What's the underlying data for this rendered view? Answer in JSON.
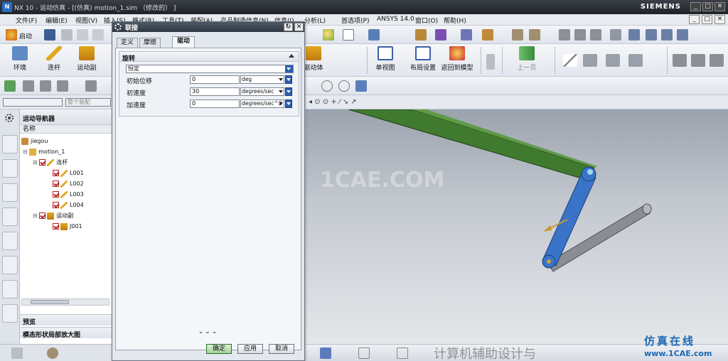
{
  "titlebar": {
    "title": "NX 10 - 运动仿真 - [(仿真) motion_1.sim （修改的） ]",
    "brand": "SIEMENS",
    "buttons": [
      "_",
      "□",
      "✕"
    ]
  },
  "menubar": {
    "items": [
      "文件(F)",
      "编辑(E)",
      "视图(V)",
      "插入(S)",
      "格式(R)",
      "工具(T)",
      "装配(A)",
      "产品制造信息(N)",
      "信息(I)",
      "分析(L)",
      "首选项(P)",
      "ANSYS 14.0",
      "窗口(O)",
      "帮助(H)"
    ],
    "right_buttons": [
      "_",
      "□",
      "✕"
    ]
  },
  "toolbar_main": {
    "start_label": "启动",
    "buttons": [
      {
        "label": "环境",
        "icon": "environment-icon"
      },
      {
        "label": "连杆",
        "icon": "link-icon"
      },
      {
        "label": "运动副",
        "icon": "joint-icon"
      },
      {
        "label": "驱动体",
        "icon": "driver-icon"
      },
      {
        "label": "单视图",
        "icon": "single-view-icon"
      },
      {
        "label": "布局设置",
        "icon": "layout-icon"
      },
      {
        "label": "返回到模型",
        "icon": "return-model-icon"
      },
      {
        "label": "上一页",
        "icon": "prev-page-icon"
      }
    ]
  },
  "filter": {
    "left_select": "",
    "right_select": "整个装配"
  },
  "navigator": {
    "title": "运动导航器",
    "column": "名称",
    "tree": [
      {
        "label": "jiegou",
        "level": 0,
        "checkbox": false
      },
      {
        "label": "motion_1",
        "level": 1,
        "checkbox": false
      },
      {
        "label": "连杆",
        "level": 2,
        "checkbox": true
      },
      {
        "label": "L001",
        "level": 3,
        "checkbox": true
      },
      {
        "label": "L002",
        "level": 3,
        "checkbox": true
      },
      {
        "label": "L003",
        "level": 3,
        "checkbox": true
      },
      {
        "label": "L004",
        "level": 3,
        "checkbox": true
      },
      {
        "label": "运动副",
        "level": 2,
        "checkbox": true
      },
      {
        "label": "J001",
        "level": 3,
        "checkbox": true
      }
    ],
    "sections": [
      "预览",
      "模态形状局部放大图"
    ]
  },
  "dialog": {
    "title": "联接",
    "tabs": [
      {
        "label": "定义",
        "active": false
      },
      {
        "label": "摩擦",
        "active": false
      },
      {
        "label": "驱动",
        "active": true
      }
    ],
    "group_title": "旋转",
    "motion_type": "恒定",
    "fields": [
      {
        "label": "初始位移",
        "value": "0",
        "unit": "deg"
      },
      {
        "label": "初速度",
        "value": "30",
        "unit": "degrees/sec"
      },
      {
        "label": "加速度",
        "value": "0",
        "unit": "degrees/sec^2"
      }
    ],
    "more": "⌄⌄⌄",
    "buttons": {
      "ok": "确定",
      "apply": "应用",
      "cancel": "取消"
    }
  },
  "watermarks": {
    "center": "1CAE.COM",
    "wechat": "计算机辅助设计与",
    "site_line1": "仿真在线",
    "site_line2": "www.1CAE.com"
  },
  "colors": {
    "link_green": "#3f7a2e",
    "link_blue": "#3a74c8",
    "link_gray": "#8a8d91",
    "accent": "#2a5db0"
  }
}
